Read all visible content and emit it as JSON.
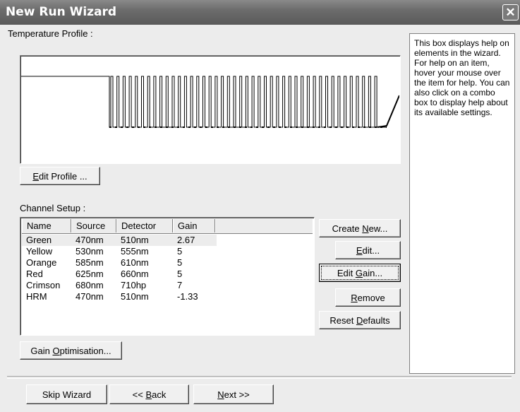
{
  "window": {
    "title": "New Run Wizard",
    "close_label": "✕"
  },
  "temperature_profile": {
    "label": "Temperature Profile :"
  },
  "edit_profile_button": {
    "mnemonic": "E",
    "rest": "dit Profile ..."
  },
  "channel_setup": {
    "label": "Channel Setup :",
    "columns": [
      "Name",
      "Source",
      "Detector",
      "Gain"
    ],
    "rows": [
      [
        "Green",
        "470nm",
        "510nm",
        "2.67"
      ],
      [
        "Yellow",
        "530nm",
        "555nm",
        "5"
      ],
      [
        "Orange",
        "585nm",
        "610nm",
        "5"
      ],
      [
        "Red",
        "625nm",
        "660nm",
        "5"
      ],
      [
        "Crimson",
        "680nm",
        "710hp",
        "7"
      ],
      [
        "HRM",
        "470nm",
        "510nm",
        "-1.33"
      ]
    ],
    "selected_row": 0
  },
  "side_buttons": {
    "create_new": {
      "pre": "Create ",
      "mnemonic": "N",
      "post": "ew..."
    },
    "edit": {
      "pre": "",
      "mnemonic": "E",
      "post": "dit..."
    },
    "edit_gain": {
      "pre": "Edit ",
      "mnemonic": "G",
      "post": "ain..."
    },
    "remove": {
      "pre": "",
      "mnemonic": "R",
      "post": "emove"
    },
    "reset_defaults": {
      "pre": "Reset ",
      "mnemonic": "D",
      "post": "efaults"
    }
  },
  "gain_optimisation_button": {
    "pre": "Gain ",
    "mnemonic": "O",
    "post": "ptimisation..."
  },
  "footer": {
    "skip": "Skip Wizard",
    "back": {
      "pre": "<< ",
      "mnemonic": "B",
      "post": "ack"
    },
    "next": {
      "pre": "",
      "mnemonic": "N",
      "post": "ext >>"
    }
  },
  "help_text": "This box displays help on elements in the wizard. For help on an item, hover your mouse over the item for help. You can also click on a combo box to display help about its available settings."
}
